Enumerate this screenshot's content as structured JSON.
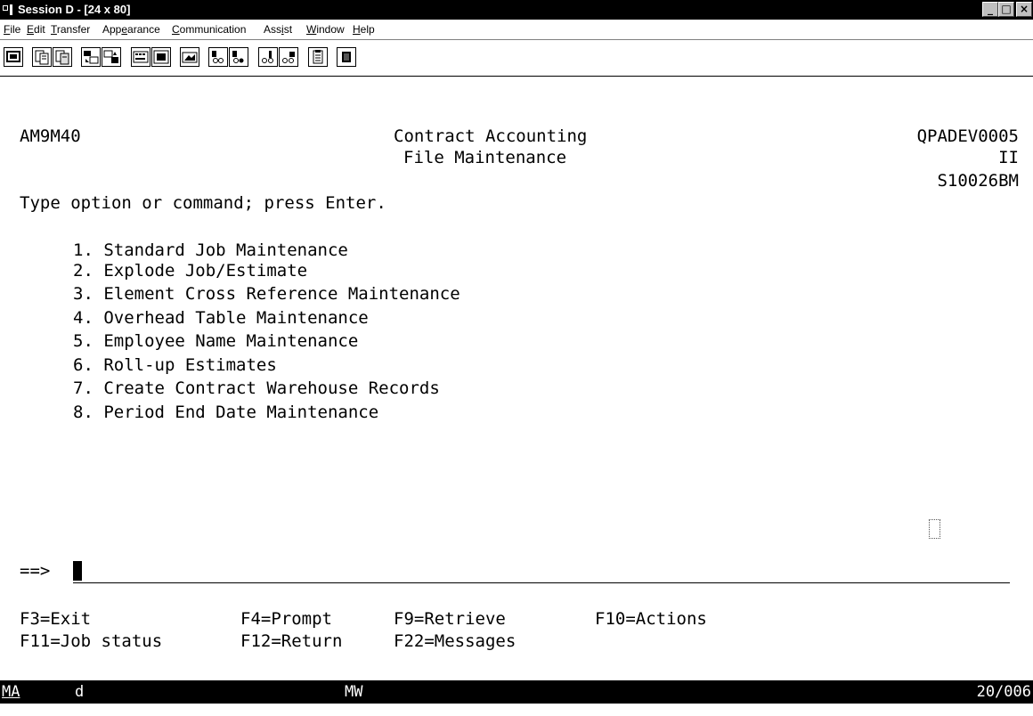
{
  "window": {
    "title": "Session D - [24 x 80]",
    "controls": {
      "minimize": "_",
      "maximize": "□",
      "close": "×"
    }
  },
  "menubar": {
    "items": [
      {
        "label": "File"
      },
      {
        "label": "Edit"
      },
      {
        "label": "Transfer"
      },
      {
        "label": "Appearance"
      },
      {
        "label": "Communication"
      },
      {
        "label": "Assist"
      },
      {
        "label": "Window"
      },
      {
        "label": "Help"
      }
    ]
  },
  "toolbar": {
    "icons": [
      "print-screen-icon",
      "copy-icon",
      "paste-icon",
      "send-file-icon",
      "receive-file-icon",
      "keypad-icon",
      "display-icon",
      "macro-icon",
      "record-macro-icon",
      "play-macro-icon",
      "start-icon",
      "stop-icon",
      "clipboard-icon",
      "color-map-icon"
    ]
  },
  "screen": {
    "program_id": "AM9M40",
    "title_line1": "Contract Accounting",
    "title_line2": "File Maintenance",
    "device": "QPADEV0005",
    "system_code": "II",
    "system_name": "S10026BM",
    "instruction": "Type option or command; press Enter.",
    "options": [
      "1. Standard Job Maintenance",
      "2. Explode Job/Estimate",
      "3. Element Cross Reference Maintenance",
      "4. Overhead Table Maintenance",
      "5. Employee Name Maintenance",
      "6. Roll-up Estimates",
      "7. Create Contract Warehouse Records",
      "8. Period End Date Maintenance"
    ],
    "prompt": "==>",
    "command_value": "",
    "function_keys": {
      "f3": "F3=Exit",
      "f4": "F4=Prompt",
      "f9": "F9=Retrieve",
      "f10": "F10=Actions",
      "f11": "F11=Job status",
      "f12": "F12=Return",
      "f22": "F22=Messages"
    }
  },
  "status": {
    "left": "MA",
    "session_letter": "d",
    "mode": "MW",
    "cursor_position": "20/006"
  }
}
